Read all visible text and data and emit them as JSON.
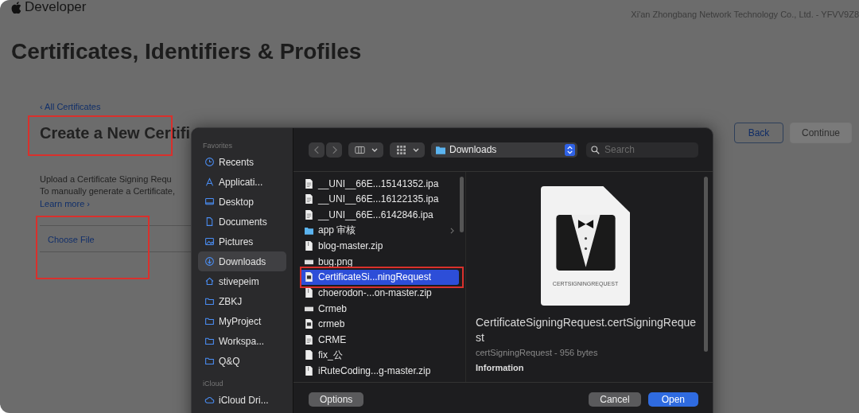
{
  "header": {
    "brand": "Developer",
    "account": "Xi'an Zhongbang Network Technology Co., Ltd. - YFVV9Z8"
  },
  "page_title": "Certificates, Identifiers & Profiles",
  "back_link": "‹ All Certificates",
  "section_title": "Create a New Certifi",
  "description": [
    "Upload a Certificate Signing Requ",
    "To manually generate a Certificate,"
  ],
  "learn_more": "Learn more ›",
  "file_field": {
    "label": "Choose File"
  },
  "buttons": [
    {
      "label": "Back",
      "disabled": false
    },
    {
      "label": "Continue",
      "disabled": true
    }
  ],
  "dialog": {
    "sidebar": [
      {
        "title": "Favorites",
        "items": [
          {
            "label": "Recents",
            "kind": "clock",
            "selected": false
          },
          {
            "label": "Applicati...",
            "kind": "apps",
            "selected": false
          },
          {
            "label": "Desktop",
            "kind": "desktop",
            "selected": false
          },
          {
            "label": "Documents",
            "kind": "doc",
            "selected": false
          },
          {
            "label": "Pictures",
            "kind": "pictures",
            "selected": false
          },
          {
            "label": "Downloads",
            "kind": "download",
            "selected": true
          },
          {
            "label": "stivepeim",
            "kind": "home",
            "selected": false
          },
          {
            "label": "ZBKJ",
            "kind": "folder",
            "selected": false
          },
          {
            "label": "MyProject",
            "kind": "folder",
            "selected": false
          },
          {
            "label": "Workspa...",
            "kind": "folder",
            "selected": false
          },
          {
            "label": "Q&Q",
            "kind": "folder",
            "selected": false
          }
        ]
      },
      {
        "title": "iCloud",
        "items": [
          {
            "label": "iCloud Dri...",
            "kind": "cloud",
            "selected": false
          }
        ]
      }
    ],
    "location": "Downloads",
    "search": {
      "placeholder": "Search"
    },
    "files": [
      {
        "name": "__UNI__66E...15141352.ipa",
        "kind": "doc",
        "selected": false
      },
      {
        "name": "__UNI__66E...16122135.ipa",
        "kind": "doc",
        "selected": false
      },
      {
        "name": "__UNI__66E...6142846.ipa",
        "kind": "doc",
        "selected": false
      },
      {
        "name": "app 审核",
        "kind": "folder",
        "selected": false
      },
      {
        "name": "blog-master.zip",
        "kind": "zip",
        "selected": false
      },
      {
        "name": "bug.png",
        "kind": "image",
        "selected": false
      },
      {
        "name": "CertificateSi...ningRequest",
        "kind": "cert",
        "selected": true
      },
      {
        "name": "choerodon-...on-master.zip",
        "kind": "zip",
        "selected": false
      },
      {
        "name": "Crmeb",
        "kind": "image",
        "selected": false
      },
      {
        "name": "crmeb",
        "kind": "cert",
        "selected": false
      },
      {
        "name": "CRME",
        "kind": "doc",
        "selected": false
      },
      {
        "name": "fix_公",
        "kind": "blank",
        "selected": false
      },
      {
        "name": "iRuteCoding...g-master.zip",
        "kind": "zip",
        "selected": false
      }
    ],
    "preview": {
      "icon_label": "CERTSIGNINGREQUEST",
      "name": "CertificateSigningRequest.certSigningRequest",
      "info": "certSigningRequest - 956 bytes",
      "section": "Information"
    },
    "options_button": "Options",
    "cancel_button": "Cancel",
    "open_button": "Open"
  }
}
